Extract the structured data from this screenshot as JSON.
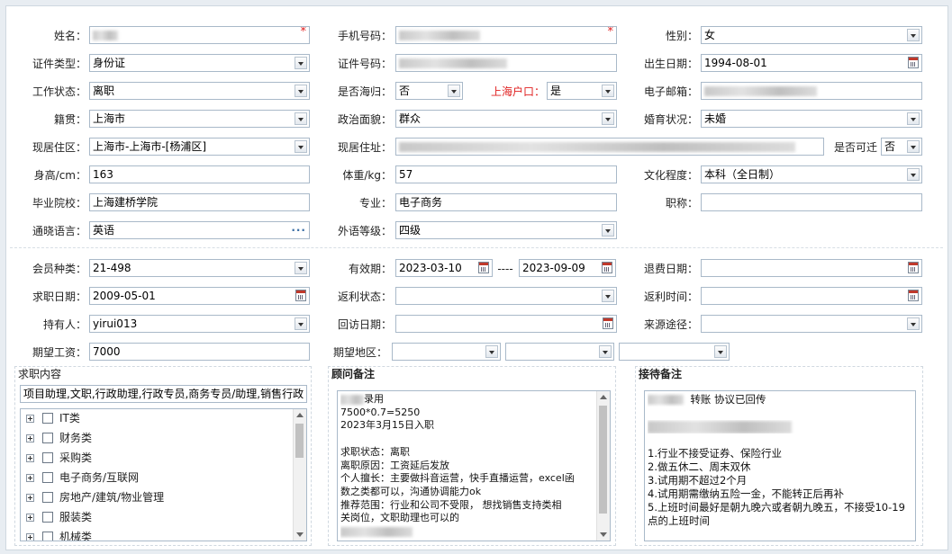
{
  "labels": {
    "name": "姓名：",
    "phone": "手机号码：",
    "gender": "性别：",
    "id_type": "证件类型：",
    "id_no": "证件号码：",
    "birth": "出生日期：",
    "work_status": "工作状态：",
    "returnee": "是否海归：",
    "sh_hukou": "上海户口：",
    "email": "电子邮箱：",
    "native": "籍贯：",
    "political": "政治面貌：",
    "marital": "婚育状况：",
    "residence_area": "现居住区：",
    "residence_addr": "现居住址：",
    "relocate": "是否可迁",
    "height": "身高/cm：",
    "weight": "体重/kg：",
    "education": "文化程度：",
    "school": "毕业院校：",
    "major": "专业：",
    "title": "职称：",
    "language": "通晓语言：",
    "foreign_level": "外语等级：",
    "member_type": "会员种类：",
    "valid_period": "有效期：",
    "refund_date": "退费日期：",
    "job_date": "求职日期：",
    "rebate_status": "返利状态：",
    "rebate_time": "返利时间：",
    "holder": "持有人：",
    "visit_date": "回访日期：",
    "source": "来源途径：",
    "salary": "期望工资：",
    "region": "期望地区："
  },
  "values": {
    "gender": "女",
    "id_type": "身份证",
    "birth": "1994-08-01",
    "work_status": "离职",
    "returnee": "否",
    "sh_hukou": "是",
    "native": "上海市",
    "political": "群众",
    "marital": "未婚",
    "residence_area": "上海市-上海市-[杨浦区]",
    "relocate": "否",
    "height": "163",
    "weight": "57",
    "education": "本科（全日制）",
    "school": "上海建桥学院",
    "major": "电子商务",
    "title": "",
    "language": "英语",
    "foreign_level": "四级",
    "member_type": "21-498",
    "valid_from": "2023-03-10",
    "valid_sep": "----",
    "valid_to": "2023-09-09",
    "refund_date": "",
    "job_date": "2009-05-01",
    "rebate_status": "",
    "rebate_time": "",
    "holder": "yirui013",
    "visit_date": "",
    "source": "",
    "salary": "7000"
  },
  "job_content": {
    "title": "求职内容",
    "summary": "项目助理,文职,行政助理,行政专员,商务专员/助理,销售行政",
    "categories": [
      "IT类",
      "财务类",
      "采购类",
      "电子商务/互联网",
      "房地产/建筑/物业管理",
      "服装类",
      "机械类"
    ]
  },
  "advisor_notes": {
    "title": "顾问备注",
    "lines": [
      "录用",
      "7500*0.7=5250",
      "2023年3月15日入职",
      "",
      "求职状态：离职",
      "离职原因：工资延后发放",
      "个人擅长：主要做抖音运营，快手直播运营，excel函",
      "数之类都可以，沟通协调能力ok",
      "推荐范围：行业和公司不受限，  想找销售支持类相",
      "关岗位，文职助理也可以的"
    ]
  },
  "reception_notes": {
    "title": "接待备注",
    "line1": "转账   协议已回传",
    "lines": [
      "1.行业不接受证券、保险行业",
      "2.做五休二、周末双休",
      "3.试用期不超过2个月",
      "4.试用期需缴纳五险一金，不能转正后再补",
      "5.上班时间最好是朝九晚六或者朝九晚五，不接受10-19",
      "点的上班时间"
    ]
  }
}
